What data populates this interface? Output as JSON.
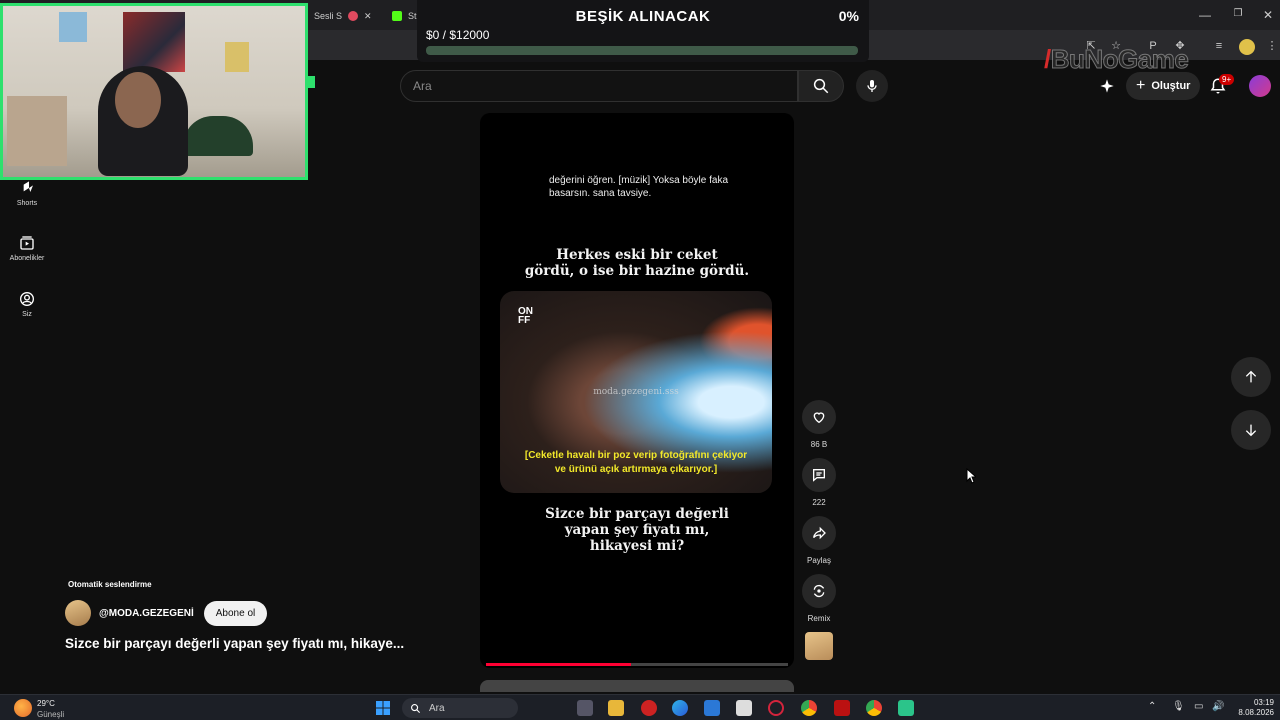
{
  "browser": {
    "tabs": [
      {
        "label": "Sesli S",
        "close": "✕"
      },
      {
        "label": "Str"
      }
    ]
  },
  "donation": {
    "title": "BEŞİK ALINACAK",
    "percent": "0%",
    "amount": "$0 / $12000",
    "progress": 0,
    "colors": {
      "fill": "#3ddc84",
      "track": "#3f5a48"
    }
  },
  "watermark_brand": "BuNoGame",
  "header": {
    "search_placeholder": "Ara",
    "create_label": "Oluştur",
    "notif_badge": "9+"
  },
  "sidebar": {
    "items": [
      {
        "label": "Shorts",
        "icon": "shorts-icon"
      },
      {
        "label": "Abonelikler",
        "icon": "subscriptions-icon"
      },
      {
        "label": "Siz",
        "icon": "you-icon"
      }
    ]
  },
  "short": {
    "caption": "değerini öğren. [müzik] Yoksa böyle faka basarsın. sana tavsiye.",
    "headline_top_1": "Herkes eski bir ceket",
    "headline_top_2": "gördü, o ise bir hazine gördü.",
    "on_logo": "ON\nFF",
    "video_watermark": "moda.gezegeni.sss",
    "video_subtitle": "[Ceketle havalı bir poz verip fotoğrafını çekiyor ve ürünü açık artırmaya çıkarıyor.]",
    "headline_bottom_1": "Sizce bir parçayı değerli",
    "headline_bottom_2": "yapan şey fiyatı mı,",
    "headline_bottom_3": "hikayesi mi?",
    "playback_progress": 0.48,
    "accent": "#ff0033"
  },
  "actions": {
    "likes": "86 B",
    "comments": "222",
    "share": "Paylaş",
    "remix": "Remix"
  },
  "overlay": {
    "autoplay": "Otomatik seslendirme",
    "channel": "@MODA.GEZEGENİ",
    "subscribe": "Abone ol",
    "title": "Sizce bir parçayı değerli yapan şey fiyatı mı, hikaye..."
  },
  "taskbar": {
    "temp": "29°C",
    "weather": "Güneşli",
    "search": "Ara",
    "time": "03:19",
    "date": "8.08.2026"
  }
}
